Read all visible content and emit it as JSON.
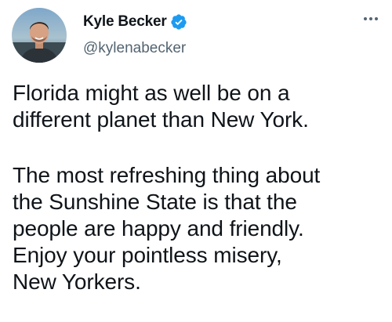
{
  "tweet": {
    "author": {
      "display_name": "Kyle Becker",
      "handle": "@kylenabecker",
      "verified": true,
      "avatar_icon": "profile-photo"
    },
    "more_icon": "more-horizontal-icon",
    "paragraphs": [
      "Florida might as well be on a\ndifferent planet than New York.",
      "The most refreshing thing about\nthe Sunshine State is that the\npeople are happy and friendly.\nEnjoy your pointless misery,\nNew Yorkers."
    ]
  },
  "colors": {
    "text": "#0f1419",
    "secondary": "#536471",
    "verified_badge": "#1d9bf0",
    "background": "#ffffff"
  }
}
